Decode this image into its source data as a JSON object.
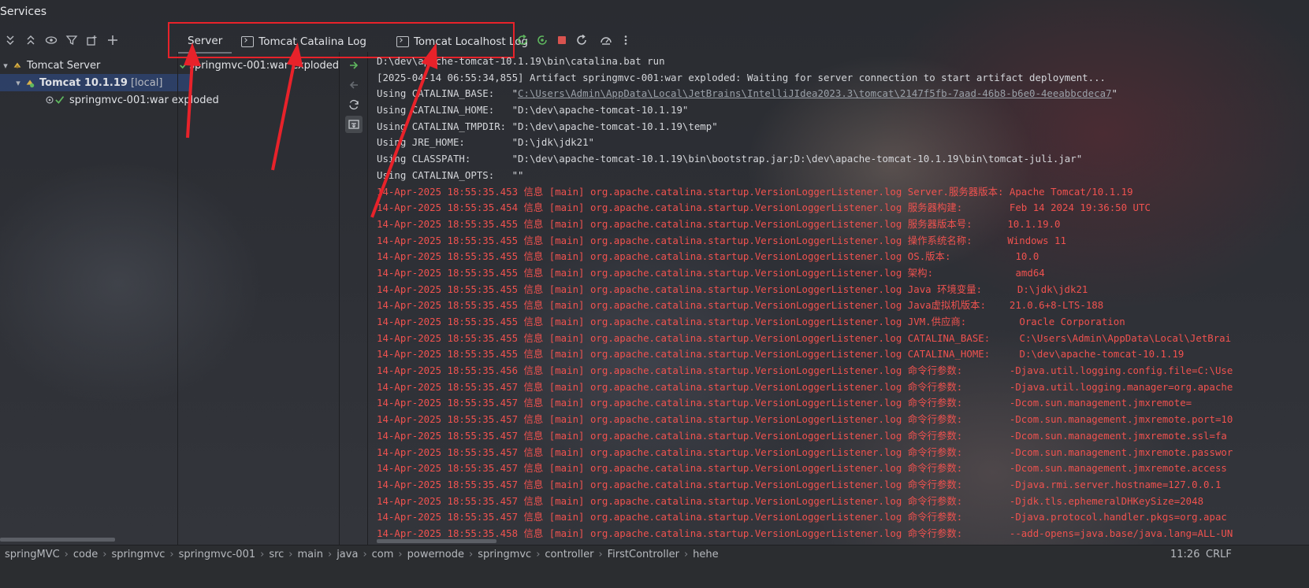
{
  "window": {
    "title": "Services"
  },
  "toolbar": {
    "left_icons": [
      "expand-all-icon",
      "collapse-all-icon",
      "eye-icon",
      "filter-icon",
      "new-tab-icon",
      "add-icon"
    ]
  },
  "tree": {
    "items": [
      {
        "label": "Tomcat Server",
        "sub": "",
        "icon": "tomcat-icon",
        "chevron": "▾"
      },
      {
        "label": "Tomcat 10.1.19",
        "sub": "[local]",
        "icon": "tomcat-running-icon",
        "chevron": "▾"
      },
      {
        "label": "springmvc-001:war exploded",
        "sub": "",
        "icon": "artifact-deployed-icon",
        "chevron": ""
      }
    ]
  },
  "tabs": [
    {
      "label": "Server",
      "active": true
    },
    {
      "label": "Tomcat Catalina Log",
      "active": false
    },
    {
      "label": "Tomcat Localhost Log",
      "active": false
    }
  ],
  "actions": [
    "update-app-icon",
    "redeploy-icon",
    "stop-icon",
    "rerun-icon",
    "dashboard-icon",
    "more-icon"
  ],
  "deployment": {
    "item": "springmvc-001:war exploded"
  },
  "gutter_icons": [
    "deploy-icon",
    "undeploy-icon",
    "refresh-icon",
    "scroll-to-end-icon"
  ],
  "console": {
    "lines": [
      {
        "type": "plain",
        "text": "D:\\dev\\apache-tomcat-10.1.19\\bin\\catalina.bat run"
      },
      {
        "type": "plain",
        "text": "[2025-04-14 06:55:34,855] Artifact springmvc-001:war exploded: Waiting for server connection to start artifact deployment..."
      },
      {
        "type": "plain",
        "pre": "Using CATALINA_BASE:   \"",
        "link": "C:\\Users\\Admin\\AppData\\Local\\JetBrains\\IntelliJIdea2023.3\\tomcat\\2147f5fb-7aad-46b8-b6e0-4eeabbcdeca7",
        "post": "\""
      },
      {
        "type": "plain",
        "text": "Using CATALINA_HOME:   \"D:\\dev\\apache-tomcat-10.1.19\""
      },
      {
        "type": "plain",
        "text": "Using CATALINA_TMPDIR: \"D:\\dev\\apache-tomcat-10.1.19\\temp\""
      },
      {
        "type": "plain",
        "text": "Using JRE_HOME:        \"D:\\jdk\\jdk21\""
      },
      {
        "type": "plain",
        "text": "Using CLASSPATH:       \"D:\\dev\\apache-tomcat-10.1.19\\bin\\bootstrap.jar;D:\\dev\\apache-tomcat-10.1.19\\bin\\tomcat-juli.jar\""
      },
      {
        "type": "plain",
        "text": "Using CATALINA_OPTS:   \"\""
      },
      {
        "type": "red",
        "text": "14-Apr-2025 18:55:35.453 信息 [main] org.apache.catalina.startup.VersionLoggerListener.log Server.服务器版本: Apache Tomcat/10.1.19"
      },
      {
        "type": "red",
        "text": "14-Apr-2025 18:55:35.454 信息 [main] org.apache.catalina.startup.VersionLoggerListener.log 服务器构建:        Feb 14 2024 19:36:50 UTC"
      },
      {
        "type": "red",
        "text": "14-Apr-2025 18:55:35.455 信息 [main] org.apache.catalina.startup.VersionLoggerListener.log 服务器版本号:      10.1.19.0"
      },
      {
        "type": "red",
        "text": "14-Apr-2025 18:55:35.455 信息 [main] org.apache.catalina.startup.VersionLoggerListener.log 操作系统名称:      Windows 11"
      },
      {
        "type": "red",
        "text": "14-Apr-2025 18:55:35.455 信息 [main] org.apache.catalina.startup.VersionLoggerListener.log OS.版本:           10.0"
      },
      {
        "type": "red",
        "text": "14-Apr-2025 18:55:35.455 信息 [main] org.apache.catalina.startup.VersionLoggerListener.log 架构:              amd64"
      },
      {
        "type": "red",
        "text": "14-Apr-2025 18:55:35.455 信息 [main] org.apache.catalina.startup.VersionLoggerListener.log Java 环境变量:      D:\\jdk\\jdk21"
      },
      {
        "type": "red",
        "text": "14-Apr-2025 18:55:35.455 信息 [main] org.apache.catalina.startup.VersionLoggerListener.log Java虚拟机版本:    21.0.6+8-LTS-188"
      },
      {
        "type": "red",
        "text": "14-Apr-2025 18:55:35.455 信息 [main] org.apache.catalina.startup.VersionLoggerListener.log JVM.供应商:         Oracle Corporation"
      },
      {
        "type": "red",
        "text": "14-Apr-2025 18:55:35.455 信息 [main] org.apache.catalina.startup.VersionLoggerListener.log CATALINA_BASE:     C:\\Users\\Admin\\AppData\\Local\\JetBrai"
      },
      {
        "type": "red",
        "text": "14-Apr-2025 18:55:35.455 信息 [main] org.apache.catalina.startup.VersionLoggerListener.log CATALINA_HOME:     D:\\dev\\apache-tomcat-10.1.19"
      },
      {
        "type": "red",
        "text": "14-Apr-2025 18:55:35.456 信息 [main] org.apache.catalina.startup.VersionLoggerListener.log 命令行参数:        -Djava.util.logging.config.file=C:\\Use"
      },
      {
        "type": "red",
        "text": "14-Apr-2025 18:55:35.457 信息 [main] org.apache.catalina.startup.VersionLoggerListener.log 命令行参数:        -Djava.util.logging.manager=org.apache"
      },
      {
        "type": "red",
        "text": "14-Apr-2025 18:55:35.457 信息 [main] org.apache.catalina.startup.VersionLoggerListener.log 命令行参数:        -Dcom.sun.management.jmxremote="
      },
      {
        "type": "red",
        "text": "14-Apr-2025 18:55:35.457 信息 [main] org.apache.catalina.startup.VersionLoggerListener.log 命令行参数:        -Dcom.sun.management.jmxremote.port=10"
      },
      {
        "type": "red",
        "text": "14-Apr-2025 18:55:35.457 信息 [main] org.apache.catalina.startup.VersionLoggerListener.log 命令行参数:        -Dcom.sun.management.jmxremote.ssl=fa"
      },
      {
        "type": "red",
        "text": "14-Apr-2025 18:55:35.457 信息 [main] org.apache.catalina.startup.VersionLoggerListener.log 命令行参数:        -Dcom.sun.management.jmxremote.passwor"
      },
      {
        "type": "red",
        "text": "14-Apr-2025 18:55:35.457 信息 [main] org.apache.catalina.startup.VersionLoggerListener.log 命令行参数:        -Dcom.sun.management.jmxremote.access"
      },
      {
        "type": "red",
        "text": "14-Apr-2025 18:55:35.457 信息 [main] org.apache.catalina.startup.VersionLoggerListener.log 命令行参数:        -Djava.rmi.server.hostname=127.0.0.1"
      },
      {
        "type": "red",
        "text": "14-Apr-2025 18:55:35.457 信息 [main] org.apache.catalina.startup.VersionLoggerListener.log 命令行参数:        -Djdk.tls.ephemeralDHKeySize=2048"
      },
      {
        "type": "red",
        "text": "14-Apr-2025 18:55:35.457 信息 [main] org.apache.catalina.startup.VersionLoggerListener.log 命令行参数:        -Djava.protocol.handler.pkgs=org.apac"
      },
      {
        "type": "red",
        "text": "14-Apr-2025 18:55:35.458 信息 [main] org.apache.catalina.startup.VersionLoggerListener.log 命令行参数:        --add-opens=java.base/java.lang=ALL-UN"
      }
    ]
  },
  "breadcrumb": [
    "springMVC",
    "code",
    "springmvc",
    "springmvc-001",
    "src",
    "main",
    "java",
    "com",
    "powernode",
    "springmvc",
    "controller",
    "FirstController",
    "hehe"
  ],
  "status": {
    "time": "11:26",
    "encoding": "CRLF"
  },
  "colors": {
    "highlight": "#e8222a",
    "error_text": "#f0524f",
    "selection": "#2e436e"
  }
}
